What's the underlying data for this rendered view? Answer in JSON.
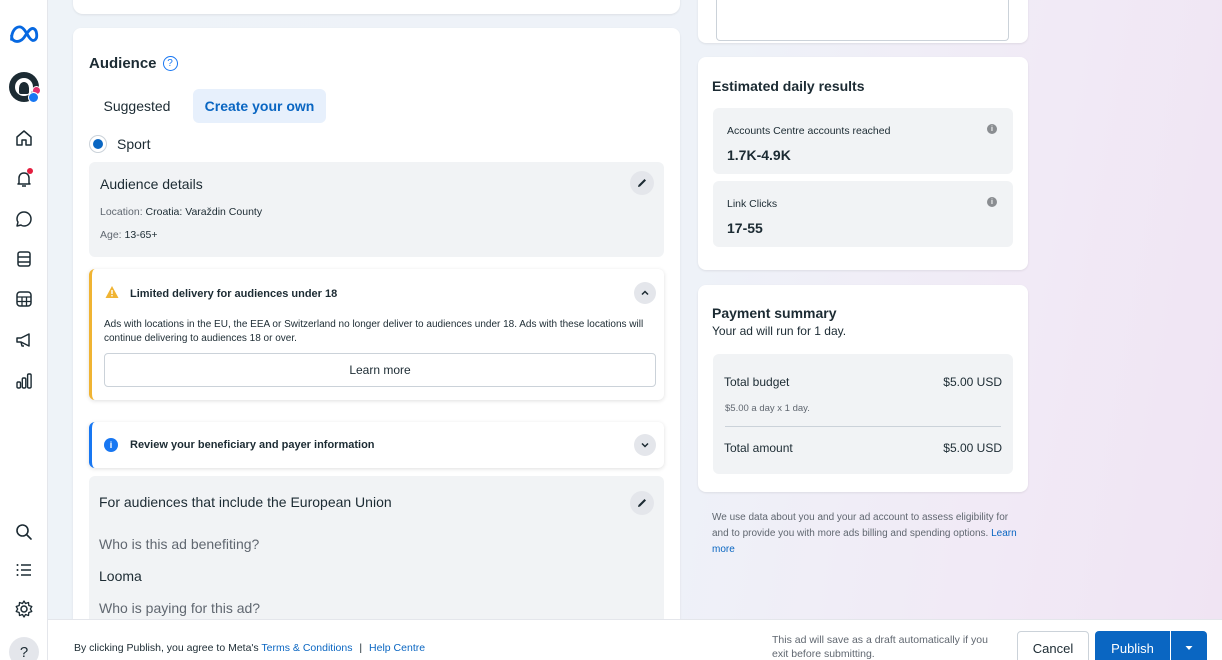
{
  "sidebar": {
    "logo": "meta-logo-icon",
    "icons": [
      "home-icon",
      "notifications-icon",
      "messages-icon",
      "content-icon",
      "planner-icon",
      "ads-megaphone-icon",
      "insights-icon",
      "search-icon",
      "menu-list-icon",
      "settings-icon"
    ],
    "help_label": "?"
  },
  "audience": {
    "title": "Audience",
    "tabs": [
      {
        "label": "Suggested",
        "selected": false
      },
      {
        "label": "Create your own",
        "selected": true
      }
    ],
    "selected_audience": "Sport",
    "details": {
      "title": "Audience details",
      "location_label": "Location:",
      "location_value": "Croatia: Varaždin County",
      "age_label": "Age:",
      "age_value": "13-65+"
    },
    "limited_delivery": {
      "title": "Limited delivery for audiences under 18",
      "body": "Ads with locations in the EU, the EEA or Switzerland no longer deliver to audiences under 18. Ads with these locations will continue delivering to audiences 18 or over.",
      "learn_more": "Learn more"
    },
    "beneficiary_alert": {
      "title": "Review your beneficiary and payer information"
    },
    "eu": {
      "title": "For audiences that include the European Union",
      "question_benefit": "Who is this ad benefiting?",
      "answer_benefit": "Looma",
      "question_paying": "Who is paying for this ad?"
    }
  },
  "estimated": {
    "title": "Estimated daily results",
    "metrics": [
      {
        "label": "Accounts Centre accounts reached",
        "value": "1.7K-4.9K"
      },
      {
        "label": "Link Clicks",
        "value": "17-55"
      }
    ]
  },
  "payment": {
    "title": "Payment summary",
    "subtitle": "Your ad will run for 1 day.",
    "total_budget_label": "Total budget",
    "total_budget_value": "$5.00 USD",
    "budget_detail": "$5.00 a day x 1 day.",
    "total_amount_label": "Total amount",
    "total_amount_value": "$5.00 USD"
  },
  "disclaimer": {
    "text": "We use data about you and your ad account to assess eligibility for and to provide you with more ads billing and spending options.",
    "link": "Learn more"
  },
  "footer": {
    "agree_text": "By clicking Publish, you agree to Meta's",
    "terms_link": "Terms & Conditions",
    "separator": "|",
    "help_link": "Help Centre",
    "draft_note": "This ad will save as a draft automatically if you exit before submitting.",
    "cancel_label": "Cancel",
    "publish_label": "Publish"
  },
  "colors": {
    "accent": "#0a66c2",
    "warning": "#f0b433",
    "info": "#1877f2"
  }
}
